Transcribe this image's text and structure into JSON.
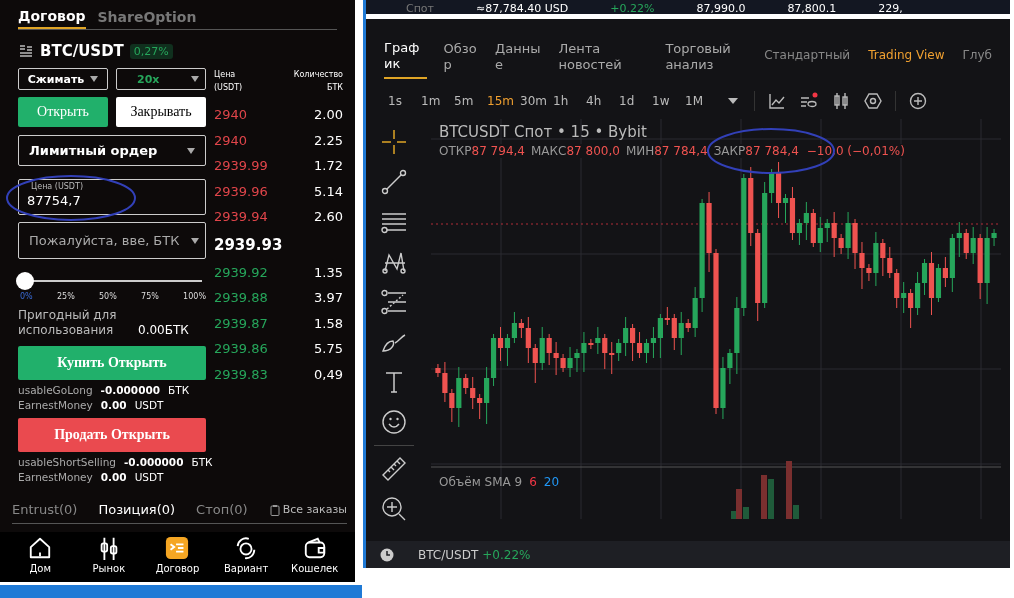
{
  "contract_panel": {
    "tabs": [
      {
        "label": "Договор",
        "selected": true
      },
      {
        "label": "ShareOption",
        "selected": false
      }
    ],
    "pair": "BTC/USDT",
    "change": "0,27%",
    "margin_mode": "Сжимать",
    "leverage": "20x",
    "side_tabs": [
      {
        "label": "Открыть",
        "selected": true
      },
      {
        "label": "Закрывать",
        "selected": false
      }
    ],
    "order_type": "Лимитный ордер",
    "price_field": {
      "label": "Цена (USDT)",
      "value": "87754,7"
    },
    "amount_field": {
      "placeholder": "Пожалуйста, вве,",
      "unit": "БТК"
    },
    "slider": {
      "level": 0,
      "marks": [
        {
          "label": "0%",
          "selected": true
        },
        {
          "label": "25%",
          "selected": false
        },
        {
          "label": "50%",
          "selected": false
        },
        {
          "label": "75%",
          "selected": false
        },
        {
          "label": "100%",
          "selected": false
        }
      ]
    },
    "available": {
      "label": "Пригодный для использования",
      "value": "0.00БТК"
    },
    "buy_button": "Купить Открыть",
    "long_info": [
      {
        "label": "usableGoLong",
        "value": "-0.000000",
        "unit": "БТК"
      },
      {
        "label": "EarnestMoney",
        "value": "0.00",
        "unit": "USDT"
      }
    ],
    "sell_button": "Продать Открыть",
    "short_info": [
      {
        "label": "usableShortSelling",
        "value": "-0.000000",
        "unit": "БТК"
      },
      {
        "label": "EarnestMoney",
        "value": "0.00",
        "unit": "USDT"
      }
    ],
    "orders_tabs": [
      {
        "label": "Entrust(0)",
        "selected": false
      },
      {
        "label": "Позиция(0)",
        "selected": true
      },
      {
        "label": "Стоп(0)",
        "selected": false
      }
    ],
    "all_orders": "Все заказы"
  },
  "order_book": {
    "price_header": "Цена (USDT)",
    "qty_header": "Количество БТК",
    "asks": [
      {
        "price": "2940",
        "qty": "2.00"
      },
      {
        "price": "2940",
        "qty": "2.25"
      },
      {
        "price": "2939.99",
        "qty": "1.72"
      },
      {
        "price": "2939.96",
        "qty": "5.14"
      },
      {
        "price": "2939.94",
        "qty": "2.60"
      }
    ],
    "last_price": "2939.93",
    "bids": [
      {
        "price": "2939.92",
        "qty": "1.35"
      },
      {
        "price": "2939.88",
        "qty": "3.97"
      },
      {
        "price": "2939.87",
        "qty": "1.58"
      },
      {
        "price": "2939.86",
        "qty": "5.75"
      },
      {
        "price": "2939.83",
        "qty": "0,49"
      }
    ]
  },
  "bottom_nav": [
    {
      "label": "Дом",
      "kind": "home",
      "selected": false
    },
    {
      "label": "Рынок",
      "kind": "market",
      "selected": false
    },
    {
      "label": "Договор",
      "kind": "contract",
      "selected": true
    },
    {
      "label": "Вариант",
      "kind": "option",
      "selected": false
    },
    {
      "label": "Кошелек",
      "kind": "wallet",
      "selected": false
    }
  ],
  "chart_panel": {
    "ticker_strip": [
      {
        "text": "Спот",
        "kind": "muted"
      },
      {
        "text": "≈87,784.40 USD",
        "kind": "plain"
      },
      {
        "text": "+0.22%",
        "kind": "up"
      },
      {
        "text": "87,990.0",
        "kind": "plain"
      },
      {
        "text": "87,800.1",
        "kind": "plain"
      },
      {
        "text": "229,",
        "kind": "plain"
      }
    ],
    "tabs": [
      {
        "label": "График",
        "selected": true
      },
      {
        "label": "Обзор",
        "selected": false
      },
      {
        "label": "Данные",
        "selected": false
      },
      {
        "label": "Лента новостей",
        "selected": false
      },
      {
        "label": "Торговый анализ",
        "selected": false
      }
    ],
    "views": [
      {
        "label": "Стандартный",
        "selected": false
      },
      {
        "label": "Trading View",
        "selected": true
      },
      {
        "label": "Глуб",
        "selected": false
      }
    ],
    "intervals": [
      {
        "label": "1s",
        "selected": false
      },
      {
        "label": "1m",
        "selected": false
      },
      {
        "label": "5m",
        "selected": false
      },
      {
        "label": "15m",
        "selected": true
      },
      {
        "label": "30m",
        "selected": false
      },
      {
        "label": "1h",
        "selected": false
      },
      {
        "label": "4h",
        "selected": false
      },
      {
        "label": "1d",
        "selected": false
      },
      {
        "label": "1w",
        "selected": false
      },
      {
        "label": "1M",
        "selected": false
      }
    ],
    "legend": {
      "title": "BTCUSDT Спот • 15 • Bybit",
      "ohlc": [
        {
          "label": "ОТКР",
          "value": "87 794,4"
        },
        {
          "label": "МАКС",
          "value": "87 800,0"
        },
        {
          "label": "МИН",
          "value": "87 784,4"
        },
        {
          "label": "ЗАКР",
          "value": "87 784,4"
        }
      ],
      "change": "−10,0 (−0,01%)"
    },
    "volume_legend": {
      "label": "Объём SMA 9",
      "values": [
        {
          "text": "6",
          "color": "#f23645"
        },
        {
          "text": "20",
          "color": "#2196f3"
        }
      ]
    },
    "status": {
      "pair": "BTC/USDT",
      "change": "+0.22%"
    }
  }
}
